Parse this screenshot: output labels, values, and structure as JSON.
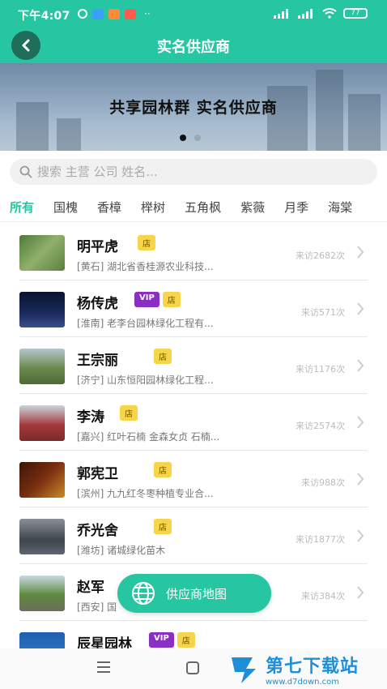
{
  "status_bar": {
    "time": "下午4:07",
    "battery": "77"
  },
  "header": {
    "title": "实名供应商"
  },
  "banner": {
    "text": "共享园林群  实名供应商"
  },
  "search": {
    "placeholder": "搜索 主营 公司 姓名..."
  },
  "tabs": [
    {
      "label": "所有",
      "active": true
    },
    {
      "label": "国槐"
    },
    {
      "label": "香樟"
    },
    {
      "label": "榉树"
    },
    {
      "label": "五角枫"
    },
    {
      "label": "紫薇"
    },
    {
      "label": "月季"
    },
    {
      "label": "海棠"
    }
  ],
  "suppliers": [
    {
      "name": "明平虎",
      "vip": false,
      "shop": "店",
      "desc": "[黄石] 湖北省香桂源农业科技...",
      "visits": "来访2682次"
    },
    {
      "name": "杨传虎",
      "vip": true,
      "vip_label": "VIP",
      "shop": "店",
      "desc": "[淮南] 老李台园林绿化工程有...",
      "visits": "来访571次"
    },
    {
      "name": "王宗丽",
      "vip": false,
      "shop": "店",
      "desc": "[济宁] 山东恒阳园林绿化工程...",
      "visits": "来访1176次"
    },
    {
      "name": "李涛",
      "vip": false,
      "shop": "店",
      "desc": "[嘉兴] 红叶石楠 金森女贞 石楠...",
      "visits": "来访2574次"
    },
    {
      "name": "郭宪卫",
      "vip": false,
      "shop": "店",
      "desc": "[滨州] 九九红冬枣种植专业合...",
      "visits": "来访988次"
    },
    {
      "name": "乔光舍",
      "vip": false,
      "shop": "店",
      "desc": "[潍坊] 诸城绿化苗木",
      "visits": "来访1877次"
    },
    {
      "name": "赵军",
      "vip": false,
      "shop": "",
      "desc": "[西安] 国",
      "visits": "来访384次"
    },
    {
      "name": "辰星园林",
      "vip": true,
      "vip_label": "VIP",
      "shop": "店",
      "desc": "",
      "visits": ""
    }
  ],
  "map_button": {
    "label": "供应商地图"
  },
  "watermark": {
    "title": "第七下载站",
    "url": "www.d7down.com"
  },
  "colors": {
    "primary": "#27c6a3",
    "vip": "#8a2fc4",
    "shop": "#f7d54a"
  }
}
